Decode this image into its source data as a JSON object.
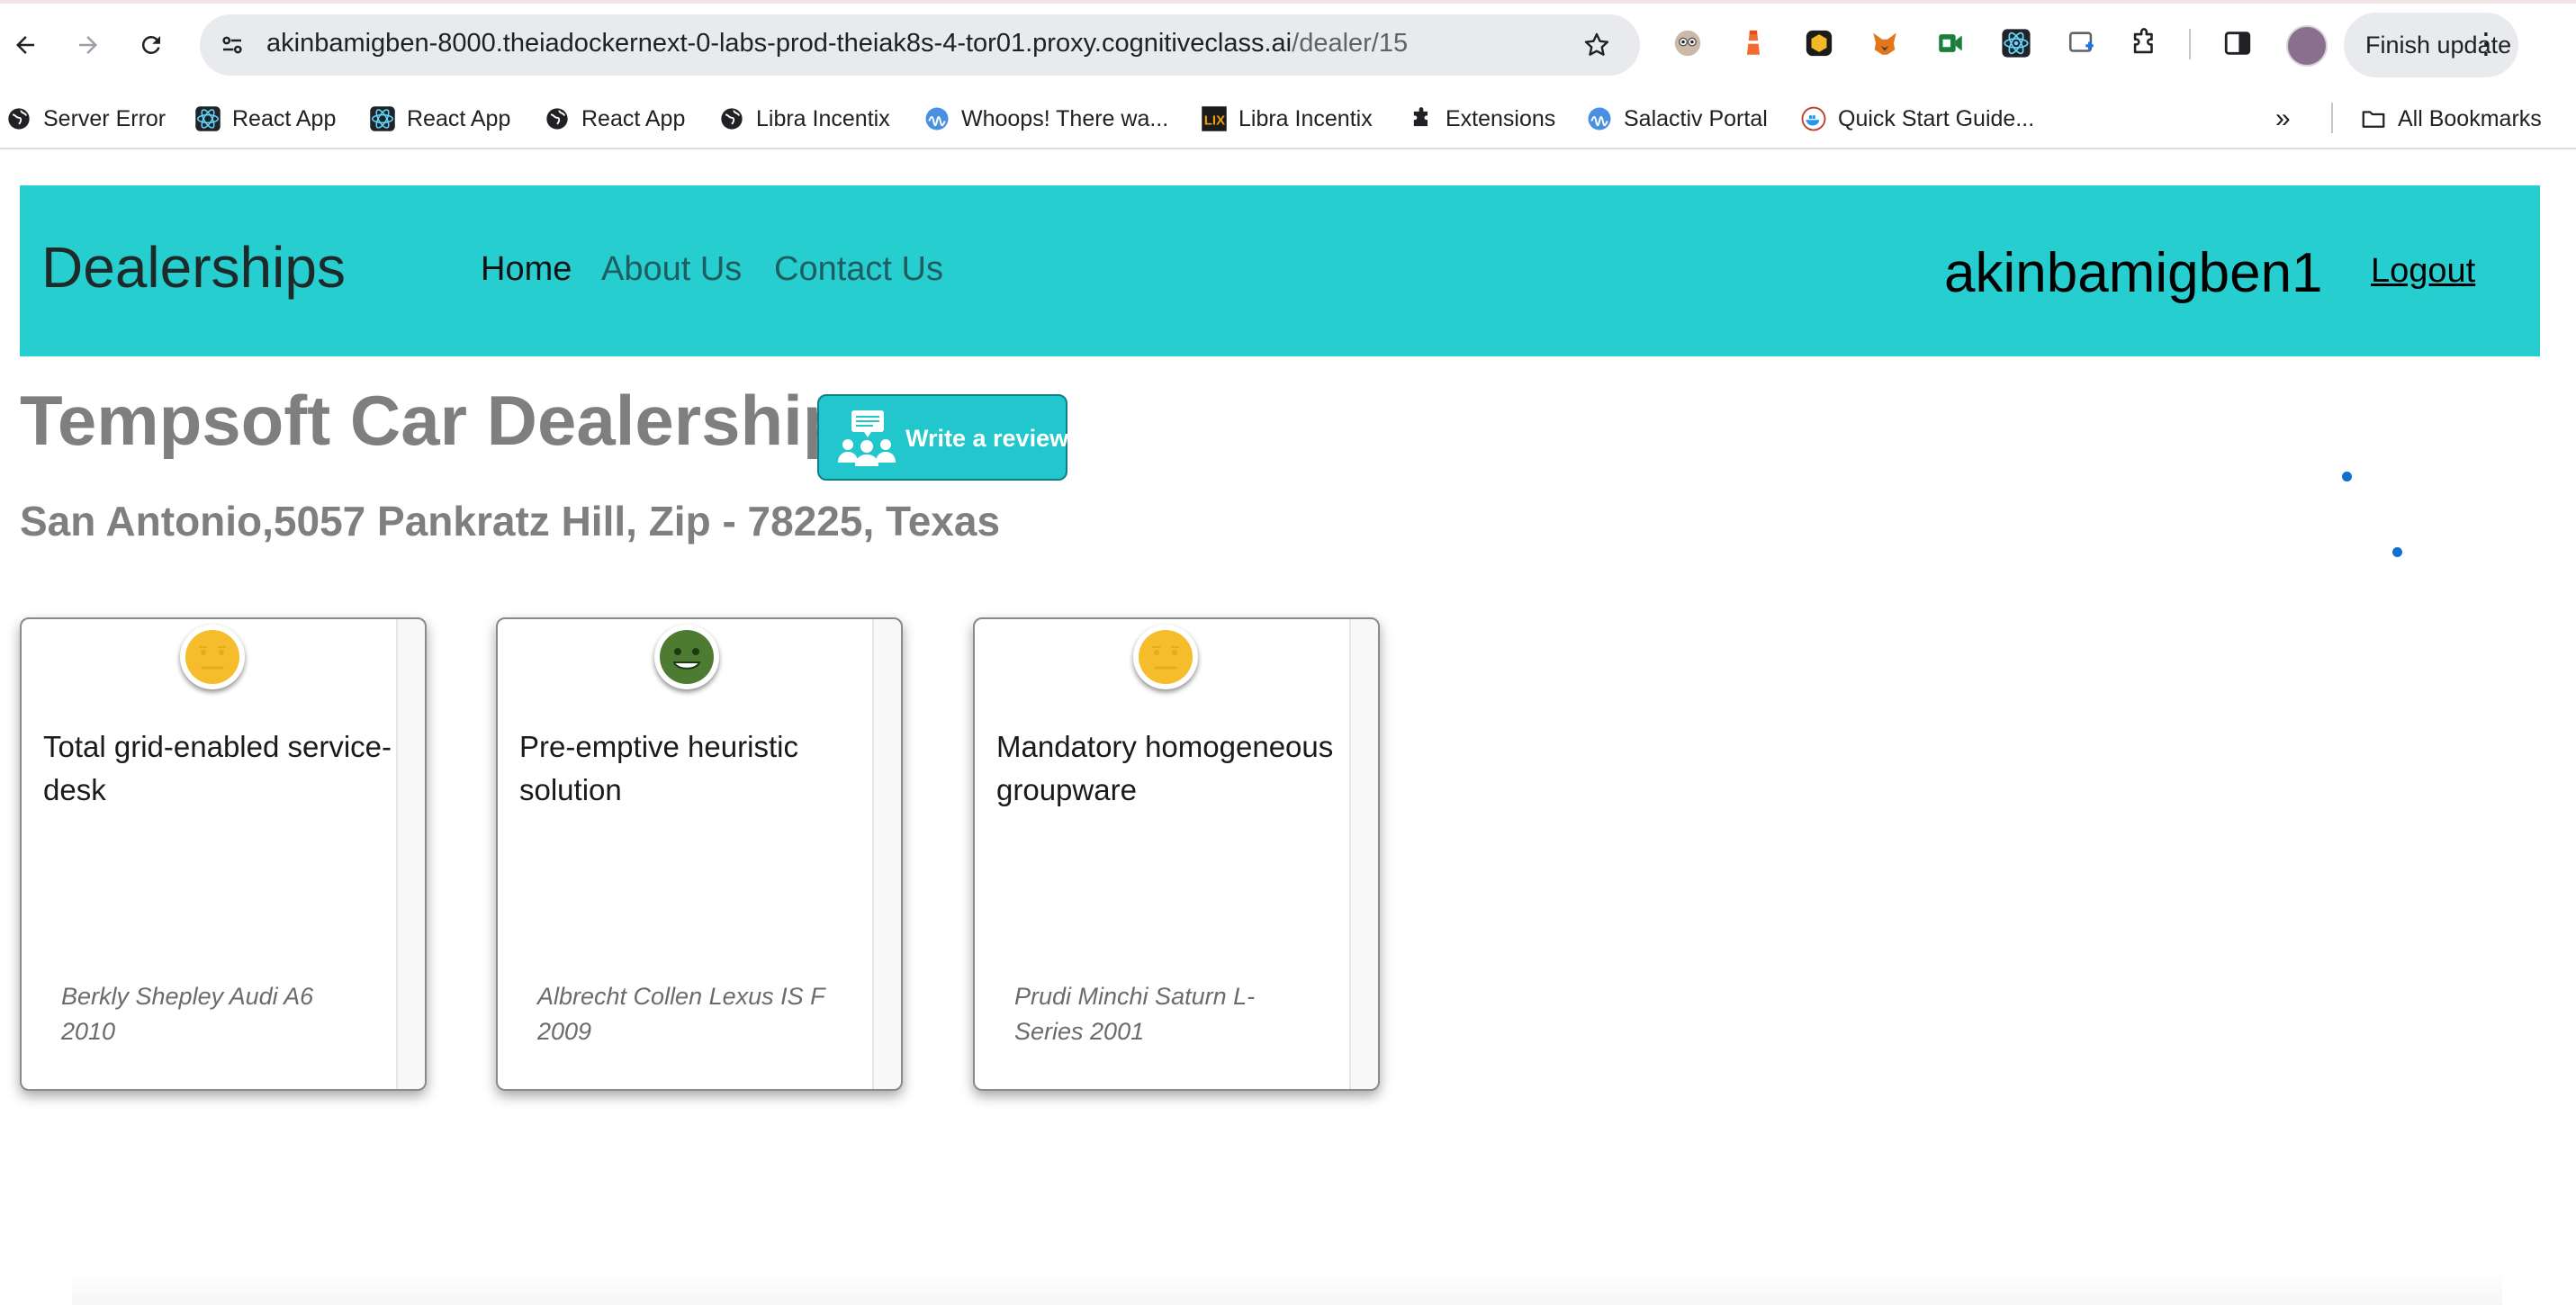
{
  "browser": {
    "url_host": "akinbamigben-8000.theiadockernext-0-labs-prod-theiak8s-4-tor01.proxy.cognitiveclass.ai",
    "url_path": "/dealer/15",
    "finish_update_label": "Finish update",
    "bookmarks": [
      {
        "label": "Server Error",
        "icon": "globe-icon"
      },
      {
        "label": "React App",
        "icon": "react-icon"
      },
      {
        "label": "React App",
        "icon": "react-icon"
      },
      {
        "label": "React App",
        "icon": "globe-icon"
      },
      {
        "label": "Libra Incentix",
        "icon": "globe-icon"
      },
      {
        "label": "Whoops! There wa...",
        "icon": "wave-icon"
      },
      {
        "label": "Libra Incentix",
        "icon": "lix-icon"
      },
      {
        "label": "Extensions",
        "icon": "puzzle-icon"
      },
      {
        "label": "Salactiv Portal",
        "icon": "wave-icon"
      },
      {
        "label": "Quick Start Guide...",
        "icon": "docker-icon"
      }
    ],
    "all_bookmarks_label": "All Bookmarks"
  },
  "nav": {
    "brand": "Dealerships",
    "links": [
      "Home",
      "About Us",
      "Contact Us"
    ],
    "username": "akinbamigben1",
    "logout_label": "Logout"
  },
  "dealer": {
    "name": "Tempsoft Car Dealership",
    "write_review_label": "Write a review",
    "address": "San Antonio,5057 Pankratz Hill, Zip - 78225, Texas"
  },
  "reviews": [
    {
      "sentiment": "neutral",
      "title": "Total grid-enabled service-desk",
      "meta": "Berkly Shepley Audi A6 2010",
      "color": "#f5bd2c"
    },
    {
      "sentiment": "positive",
      "title": "Pre-emptive heuristic solution",
      "meta": "Albrecht Collen Lexus IS F 2009",
      "color": "#4e7b32"
    },
    {
      "sentiment": "neutral",
      "title": "Mandatory homogeneous groupware",
      "meta": "Prudi Minchi Saturn L-Series 2001",
      "color": "#f5bd2c"
    }
  ],
  "colors": {
    "nav_bg": "#26ced0",
    "button_bg": "#22c7cd",
    "heading_gray": "#7f7f7f"
  }
}
